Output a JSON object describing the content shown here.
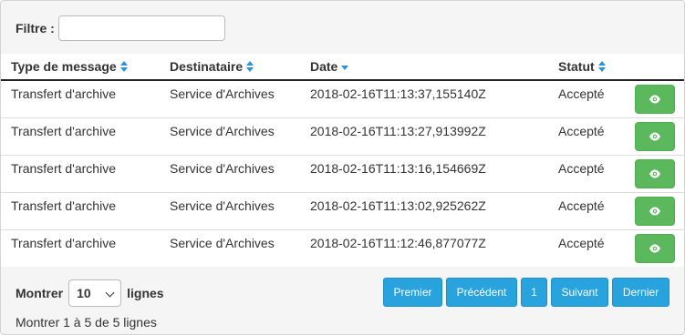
{
  "filter": {
    "label": "Filtre :",
    "value": "",
    "placeholder": ""
  },
  "table": {
    "headers": [
      {
        "label": "Type de message",
        "sort": "both"
      },
      {
        "label": "Destinataire",
        "sort": "both"
      },
      {
        "label": "Date",
        "sort": "desc"
      },
      {
        "label": "Statut",
        "sort": "both"
      }
    ],
    "rows": [
      {
        "type": "Transfert d'archive",
        "recipient": "Service d'Archives",
        "date": "2018-02-16T11:13:37,155140Z",
        "status": "Accepté"
      },
      {
        "type": "Transfert d'archive",
        "recipient": "Service d'Archives",
        "date": "2018-02-16T11:13:27,913992Z",
        "status": "Accepté"
      },
      {
        "type": "Transfert d'archive",
        "recipient": "Service d'Archives",
        "date": "2018-02-16T11:13:16,154669Z",
        "status": "Accepté"
      },
      {
        "type": "Transfert d'archive",
        "recipient": "Service d'Archives",
        "date": "2018-02-16T11:13:02,925262Z",
        "status": "Accepté"
      },
      {
        "type": "Transfert d'archive",
        "recipient": "Service d'Archives",
        "date": "2018-02-16T11:12:46,877077Z",
        "status": "Accepté"
      }
    ],
    "row_action_icon": "eye-icon"
  },
  "footer": {
    "show_label": "Montrer",
    "page_size": "10",
    "lines_label": "lignes",
    "info": "Montrer 1 à 5 de 5 lignes"
  },
  "pagination": {
    "first": "Premier",
    "previous": "Précédent",
    "current": "1",
    "next": "Suivant",
    "last": "Dernier"
  },
  "colors": {
    "accent_blue": "#29a3dd",
    "success_green": "#5cb85c",
    "sort_icon": "#2f8fd8"
  }
}
